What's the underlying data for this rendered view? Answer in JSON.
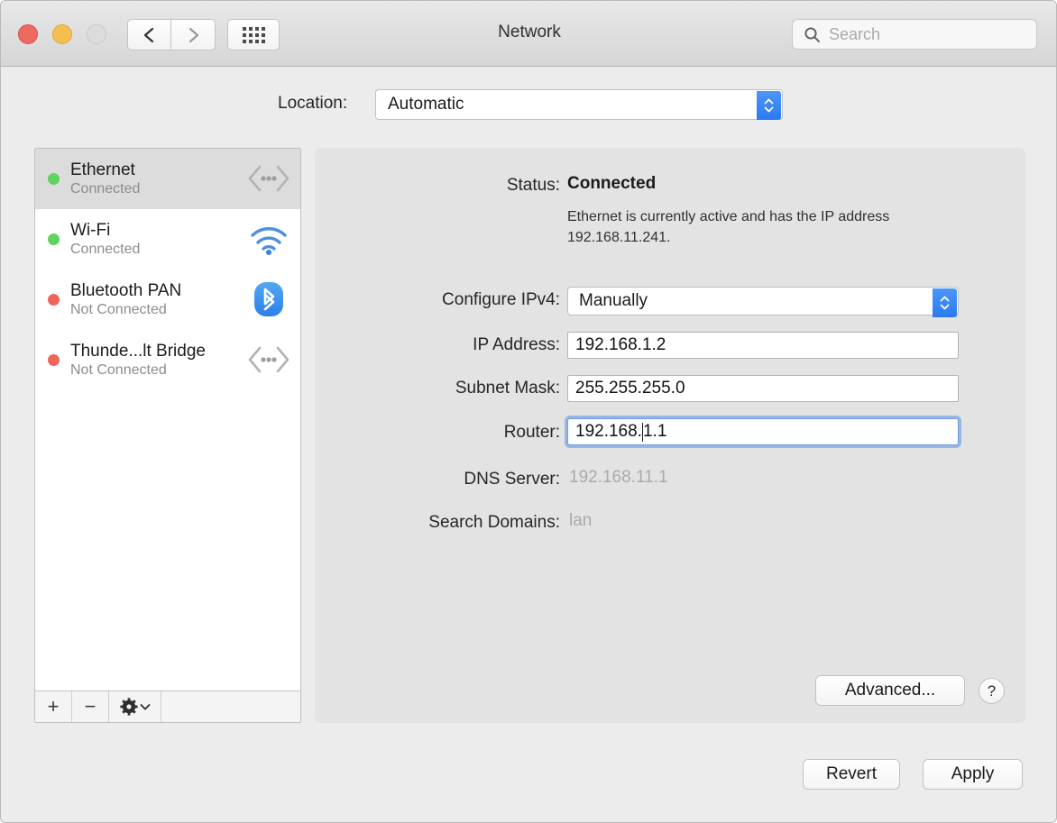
{
  "window": {
    "title": "Network",
    "traffic_lights": [
      "close",
      "minimize",
      "zoom"
    ],
    "back_label": "‹",
    "forward_label": "›",
    "grid_label": "show-all"
  },
  "search": {
    "placeholder": "Search",
    "value": ""
  },
  "location": {
    "label": "Location:",
    "value": "Automatic"
  },
  "sidebar": {
    "interfaces": [
      {
        "name": "Ethernet",
        "state": "Connected",
        "status_color": "#5fd35f",
        "icon": "ethernet-icon",
        "selected": true
      },
      {
        "name": "Wi-Fi",
        "state": "Connected",
        "status_color": "#5fd35f",
        "icon": "wifi-icon",
        "selected": false
      },
      {
        "name": "Bluetooth PAN",
        "state": "Not Connected",
        "status_color": "#f0645a",
        "icon": "bluetooth-icon",
        "selected": false
      },
      {
        "name": "Thunde...lt Bridge",
        "state": "Not Connected",
        "status_color": "#f0645a",
        "icon": "ethernet-icon",
        "selected": false
      }
    ],
    "toolbar": {
      "add_label": "+",
      "remove_label": "−",
      "action_label": "gear-dropdown"
    }
  },
  "main": {
    "status": {
      "label": "Status:",
      "value": "Connected",
      "description": "Ethernet is currently active and has the IP address 192.168.11.241."
    },
    "fields": [
      {
        "label": "Configure IPv4:",
        "value": "Manually",
        "type": "popup",
        "focused": false,
        "enabled": true
      },
      {
        "label": "IP Address:",
        "value": "192.168.1.2",
        "type": "text",
        "focused": false,
        "enabled": true
      },
      {
        "label": "Subnet Mask:",
        "value": "255.255.255.0",
        "type": "text",
        "focused": false,
        "enabled": true
      },
      {
        "label": "Router:",
        "value": "192.168.1.1",
        "type": "text",
        "focused": true,
        "enabled": true,
        "caret_after": "192.168."
      },
      {
        "label": "DNS Server:",
        "value": "192.168.11.1",
        "type": "static",
        "focused": false,
        "enabled": false
      },
      {
        "label": "Search Domains:",
        "value": "lan",
        "type": "static",
        "focused": false,
        "enabled": false
      }
    ],
    "advanced_label": "Advanced...",
    "help_label": "?"
  },
  "footer": {
    "revert_label": "Revert",
    "apply_label": "Apply"
  },
  "colors": {
    "accent": "#2a7bf0",
    "focus_ring": "#5d91e2",
    "connected": "#5fd35f",
    "disconnected": "#f0645a",
    "panel_bg": "#e3e3e3",
    "window_bg": "#ececec"
  }
}
